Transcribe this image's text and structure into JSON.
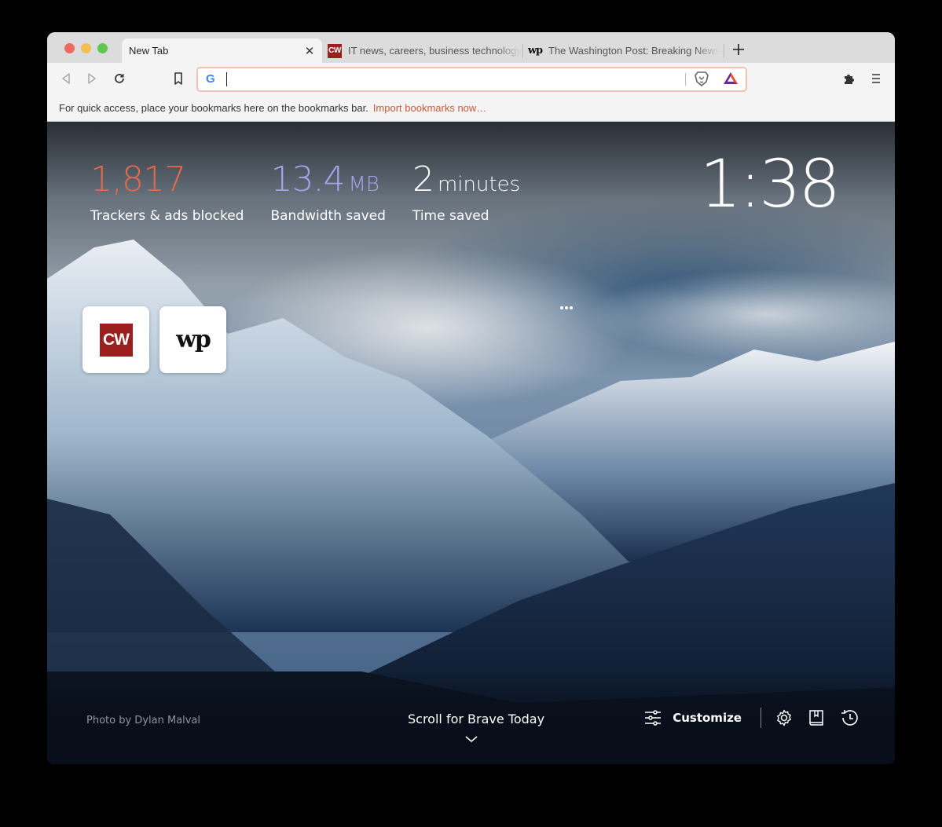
{
  "tabs": [
    {
      "title": "New Tab",
      "active": true,
      "favicon": "none",
      "close_icon": "close-icon"
    },
    {
      "title": "IT news, careers, business technology",
      "active": false,
      "favicon": "CW"
    },
    {
      "title": "The Washington Post: Breaking News",
      "active": false,
      "favicon": "wp"
    }
  ],
  "new_tab_label": "+",
  "toolbar": {
    "back_icon": "back-icon",
    "forward_icon": "forward-icon",
    "reload_icon": "reload-icon",
    "bookmark_icon": "bookmark-icon",
    "omnibox": {
      "value": "",
      "placeholder": "",
      "search_engine": "G"
    },
    "brave_shields_icon": "brave-lion-icon",
    "rewards_icon": "bat-triangle-icon",
    "extensions_icon": "puzzle-icon",
    "menu_icon": "hamburger-icon"
  },
  "bookmarks_bar": {
    "message": "For quick access, place your bookmarks here on the bookmarks bar.",
    "import_link": "Import bookmarks now…"
  },
  "ntp": {
    "stats": [
      {
        "value": "1,817",
        "unit": "",
        "label": "Trackers & ads blocked",
        "color": "#e5694b"
      },
      {
        "value": "13.4",
        "unit": "MB",
        "label": "Bandwidth saved",
        "color": "#a6a3ea"
      },
      {
        "value": "2",
        "unit": "minutes",
        "label": "Time saved",
        "color": "#ffffff"
      }
    ],
    "clock": "1:38",
    "top_sites": [
      {
        "name": "Computerworld",
        "logo": "CW"
      },
      {
        "name": "The Washington Post",
        "logo": "wp"
      }
    ],
    "more_icon": "ellipsis-icon",
    "photo_credit": "Photo by Dylan Malval",
    "scroll_prompt": "Scroll for Brave Today",
    "customize_label": "Customize",
    "bottom_icons": [
      "settings-icon",
      "bookmarks-icon",
      "history-icon"
    ]
  },
  "colors": {
    "accent_link": "#d0583b",
    "omnibox_border": "#f0c3b4",
    "tracker_count": "#e5694b",
    "bandwidth": "#a6a3ea"
  }
}
